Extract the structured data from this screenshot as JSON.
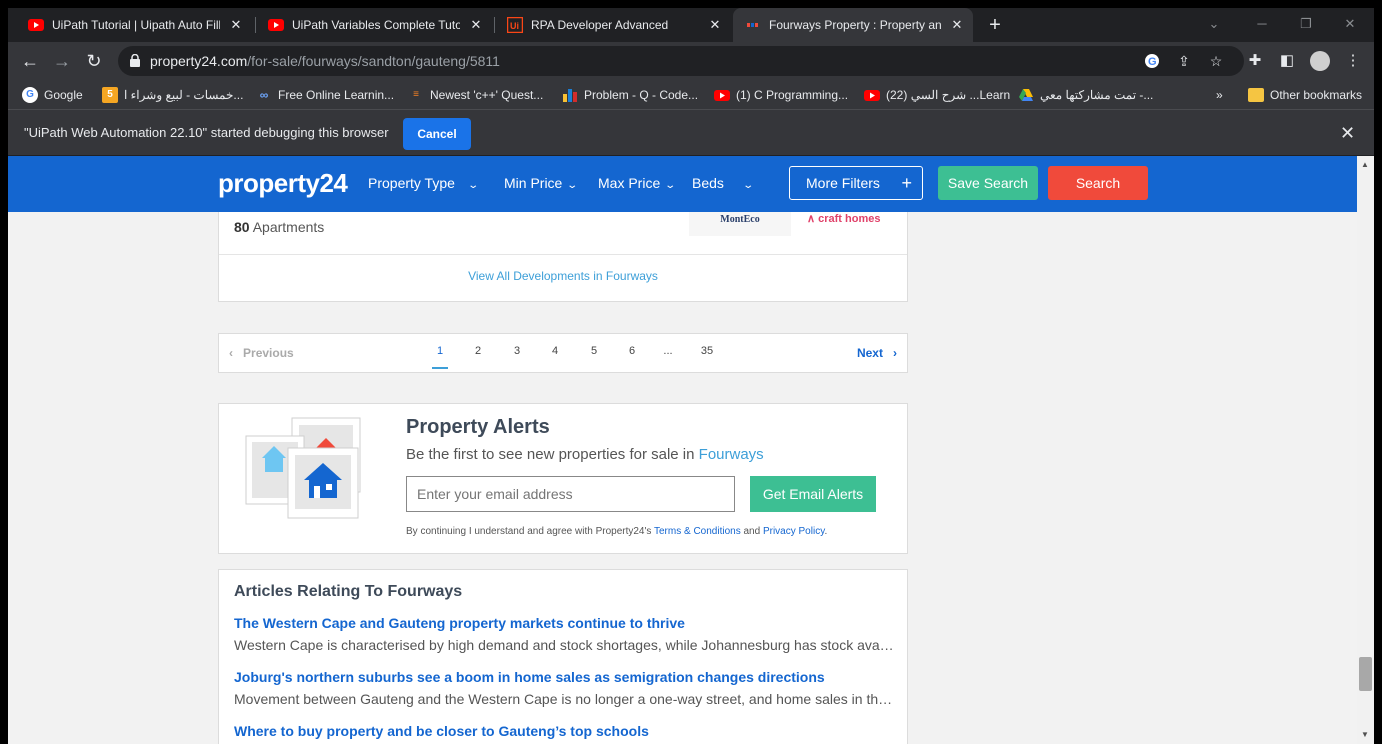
{
  "browser": {
    "tabs": [
      {
        "title": "UiPath Tutorial | Uipath Auto Fill",
        "favicon": "youtube-icon"
      },
      {
        "title": "UiPath Variables Complete Tutori",
        "favicon": "youtube-icon"
      },
      {
        "title": "RPA Developer Advanced",
        "favicon": "uipath-icon"
      },
      {
        "title": "Fourways Property : Property and",
        "favicon": "property24-icon",
        "active": true
      }
    ],
    "url_host": "property24.com",
    "url_path": "/for-sale/fourways/sandton/gauteng/5811",
    "bookmarks": [
      {
        "label": "Google",
        "icon": "google-icon"
      },
      {
        "label": "خمسات - لبيع وشراء ا...",
        "icon": "khamsat-icon"
      },
      {
        "label": "Free Online Learnin...",
        "icon": "coursera-icon"
      },
      {
        "label": "Newest 'c++' Quest...",
        "icon": "stackoverflow-icon"
      },
      {
        "label": "Problem - Q - Code...",
        "icon": "codeforces-icon"
      },
      {
        "label": "(1) C Programming...",
        "icon": "youtube-icon"
      },
      {
        "label": "(22) شرح السي ...Learn",
        "icon": "youtube-icon"
      },
      {
        "label": "تمت مشاركتها معي -...",
        "icon": "drive-icon"
      }
    ],
    "bookmarks_overflow": "»",
    "other_bookmarks": "Other bookmarks",
    "debug_message": "\"UiPath Web Automation 22.10\" started debugging this browser",
    "debug_cancel": "Cancel"
  },
  "site": {
    "logo": "property24",
    "nav": {
      "property_type": "Property Type",
      "min_price": "Min Price",
      "max_price": "Max Price",
      "beds": "Beds",
      "more_filters": "More Filters",
      "save_search": "Save Search",
      "search": "Search"
    },
    "developments": {
      "count": "80",
      "count_label": " Apartments",
      "view_all": "View All Developments in Fourways",
      "logo1": "MontEco",
      "logo2": "craft homes"
    },
    "pagination": {
      "previous": "Previous",
      "next": "Next",
      "pages": [
        "1",
        "2",
        "3",
        "4",
        "5",
        "6",
        "...",
        "35"
      ],
      "current": "1"
    },
    "alerts": {
      "title": "Property Alerts",
      "subtitle_prefix": "Be the first to see new properties for sale in ",
      "location": "Fourways",
      "email_placeholder": "Enter your email address",
      "button": "Get Email Alerts",
      "terms_prefix": "By continuing I understand and agree with Property24's ",
      "terms_link": "Terms & Conditions",
      "terms_and": " and ",
      "privacy_link": "Privacy Policy",
      "terms_suffix": "."
    },
    "articles": {
      "heading": "Articles Relating To Fourways",
      "items": [
        {
          "title": "The Western Cape and Gauteng property markets continue to thrive",
          "desc": "Western Cape is characterised by high demand and stock shortages, while Johannesburg has stock available"
        },
        {
          "title": "Joburg's northern suburbs see a boom in home sales as semigration changes directions",
          "desc": "Movement between Gauteng and the Western Cape is no longer a one-way street, and home sales in the northern suburbs"
        },
        {
          "title": "Where to buy property and be closer to Gauteng’s top schools",
          "desc": ""
        }
      ]
    }
  },
  "colors": {
    "brand_blue": "#1466d0",
    "save_green": "#3dbf93",
    "search_red": "#f04a3b",
    "link_blue": "#3d9fd8"
  }
}
